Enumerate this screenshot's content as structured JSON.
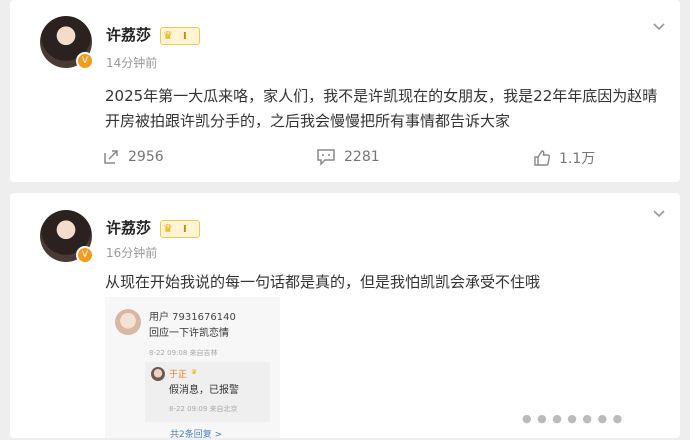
{
  "posts": [
    {
      "username": "许荔莎",
      "level": "I",
      "time": "14分钟前",
      "text": "2025年第一大瓜来咯，家人们，我不是许凯现在的女朋友，我是22年年底因为赵晴开房被拍跟许凯分手的，之后我会慢慢把所有事情都告诉大家",
      "actions": {
        "reposts": "2956",
        "comments": "2281",
        "likes": "1.1万"
      },
      "avatar_badge": "V"
    },
    {
      "username": "许荔莎",
      "level": "I",
      "time": "16分钟前",
      "text": "从现在开始我说的每一句话都是真的，但是我怕凯凯会承受不住哦",
      "avatar_badge": "V",
      "quote": {
        "user": "用户 7931676140",
        "message": "回应一下许凯恋情",
        "time": "8-22 09:08  来自吉林",
        "reply": {
          "user": "于正",
          "message": "假消息，已报警",
          "time": "8-22 09:09  来自北京"
        },
        "more": "共2条回复 >"
      }
    }
  ],
  "icons": {
    "repost": "repost-icon",
    "comment": "comment-icon",
    "like": "thumbs-up-icon",
    "menu": "chevron-down-icon",
    "crown": "crown-icon"
  },
  "colors": {
    "badge_orange": "#f39b1c",
    "link_blue": "#4a7fbf",
    "muted_gray": "#999999"
  }
}
